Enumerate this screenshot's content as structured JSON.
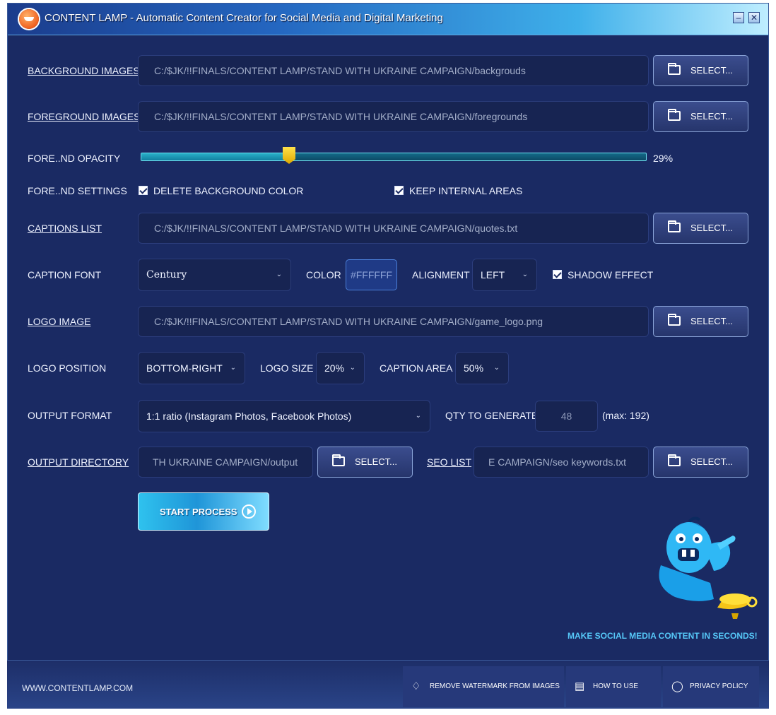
{
  "window": {
    "title": "CONTENT LAMP - Automatic Content Creator for Social Media and Digital Marketing",
    "minimize": "–",
    "close": "✕"
  },
  "background_images": {
    "label": "BACKGROUND IMAGES",
    "value": "C:/$JK/!!FINALS/CONTENT LAMP/STAND WITH UKRAINE CAMPAIGN/backgrouds",
    "button": "SELECT..."
  },
  "foreground_images": {
    "label": "FOREGROUND IMAGES",
    "value": "C:/$JK/!!FINALS/CONTENT LAMP/STAND WITH UKRAINE CAMPAIGN/foregrounds",
    "button": "SELECT..."
  },
  "opacity": {
    "label": "FORE..ND OPACITY",
    "value_label": "29%",
    "value": 29
  },
  "fore_settings": {
    "label": "FORE..ND SETTINGS",
    "delete_bg": {
      "label": "DELETE BACKGROUND COLOR",
      "checked": true
    },
    "keep_internal": {
      "label": "KEEP INTERNAL AREAS",
      "checked": true
    }
  },
  "captions_list": {
    "label": "CAPTIONS LIST",
    "value": "C:/$JK/!!FINALS/CONTENT LAMP/STAND WITH UKRAINE CAMPAIGN/quotes.txt",
    "button": "SELECT..."
  },
  "caption_font": {
    "label": "CAPTION FONT",
    "font": "Century",
    "color_label": "COLOR",
    "color": "#FFFFFF",
    "alignment_label": "ALIGNMENT",
    "alignment": "LEFT",
    "shadow_label": "SHADOW EFFECT",
    "shadow_checked": true
  },
  "logo_image": {
    "label": "LOGO IMAGE",
    "value": "C:/$JK/!!FINALS/CONTENT LAMP/STAND WITH UKRAINE CAMPAIGN/game_logo.png",
    "button": "SELECT..."
  },
  "logo_position": {
    "label": "LOGO POSITION",
    "value": "BOTTOM-RIGHT",
    "size_label": "LOGO SIZE",
    "size": "20%",
    "area_label": "CAPTION AREA",
    "area": "50%"
  },
  "output_format": {
    "label": "OUTPUT FORMAT",
    "value": "1:1 ratio (Instagram Photos, Facebook Photos)",
    "qty_label": "QTY TO GENERATE",
    "qty": "48",
    "max": "(max: 192)"
  },
  "output_directory": {
    "label": "OUTPUT DIRECTORY",
    "value": "TH UKRAINE CAMPAIGN/output",
    "button": "SELECT...",
    "seo_label": "SEO LIST",
    "seo_value": "E CAMPAIGN/seo keywords.txt",
    "seo_button": "SELECT..."
  },
  "start_button": "START PROCESS",
  "tagline": "MAKE SOCIAL MEDIA CONTENT IN SECONDS!",
  "footer": {
    "website": "WWW.CONTENTLAMP.COM",
    "remove_watermark": "REMOVE WATERMARK FROM IMAGES",
    "how_to_use": "HOW TO USE",
    "privacy_policy": "PRIVACY POLICY"
  },
  "colors": {
    "accent": "#3fb0ea",
    "panel": "#1a2a63",
    "slider_thumb": "#ffd21a",
    "tagline": "#56c8f8"
  }
}
